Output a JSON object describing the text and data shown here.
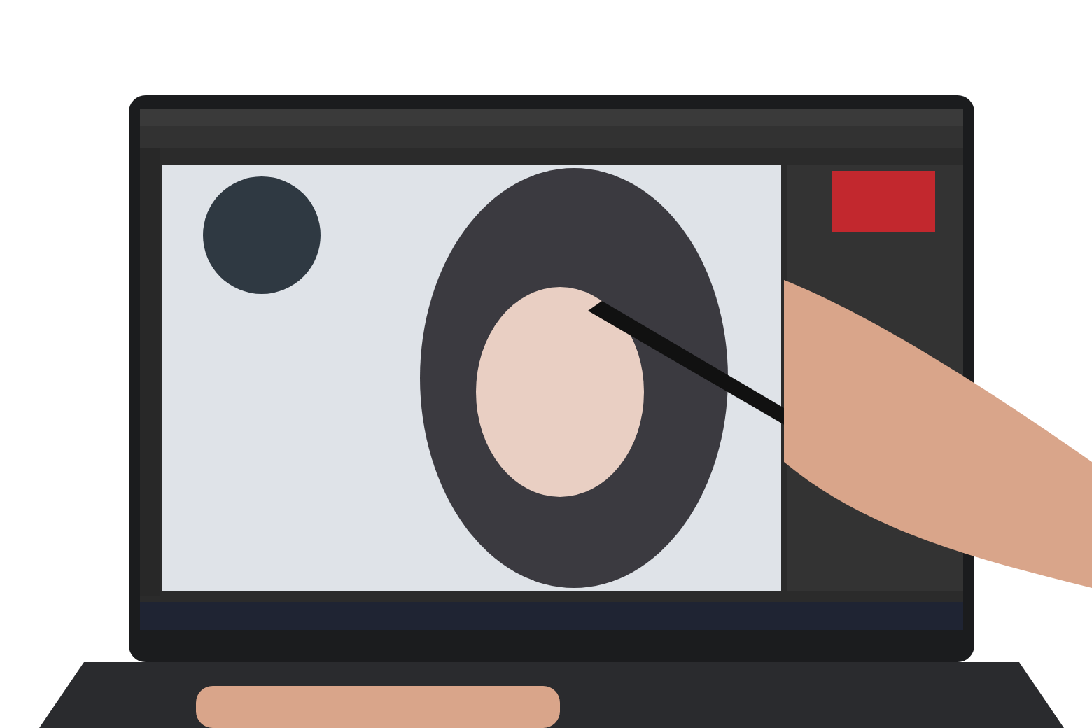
{
  "photo": {
    "kind": "laptop"
  }
}
